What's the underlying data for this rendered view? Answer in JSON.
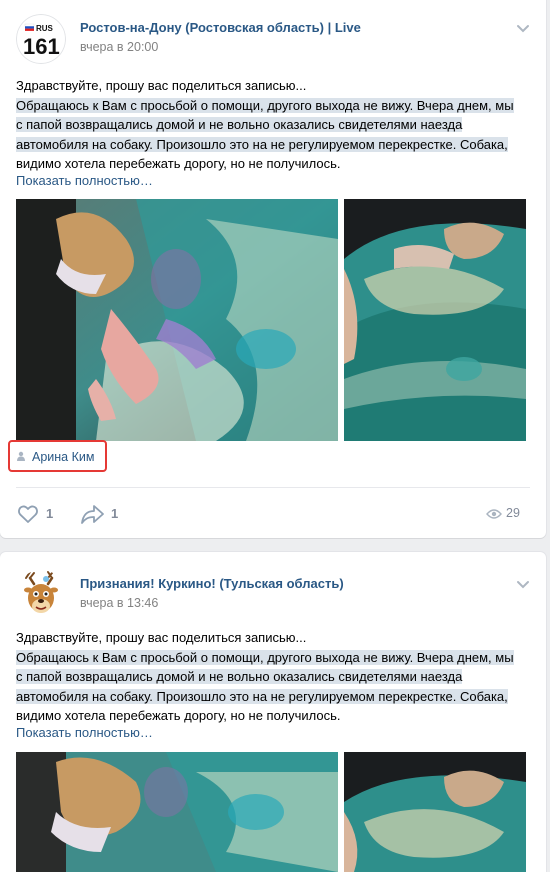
{
  "posts": [
    {
      "author": "Ростов-на-Дону (Ростовская область) | Live",
      "date": "вчера в 20:00",
      "avatar_text_top": "RUS",
      "avatar_text_bottom": "161",
      "line1": "Здравствуйте, прошу вас поделиться записью...",
      "line2": "Обращаюсь к Вам с просьбой о помощи, другого выхода не вижу. Вчера днем, мы",
      "line3": "с папой возвращались домой и не вольно оказались свидетелями наезда",
      "line4": "автомобиля на собаку. Произошло это на не регулируемом перекрестке. Собака,",
      "line5": "видимо хотела перебежать дорогу, но не получилось.",
      "show_more": "Показать полностью…",
      "signer": "Арина Ким",
      "likes": "1",
      "shares": "1",
      "views": "29"
    },
    {
      "author": "Признания! Куркино! (Тульская область)",
      "date": "вчера в 13:46",
      "line1": "Здравствуйте, прошу вас поделиться записью...",
      "line2": "Обращаюсь к Вам с просьбой о помощи, другого выхода не вижу. Вчера днем, мы",
      "line3": "с папой возвращались домой и не вольно оказались свидетелями наезда",
      "line4": "автомобиля на собаку. Произошло это на не регулируемом перекрестке. Собака,",
      "line5": "видимо хотела перебежать дорогу, но не получилось.",
      "show_more": "Показать полностью…"
    }
  ],
  "icons": {
    "chevron": "chevron-down-icon",
    "like": "heart-icon",
    "share": "share-arrow-icon",
    "views": "eye-icon",
    "signer": "person-icon"
  },
  "colors": {
    "link": "#2a5885",
    "muted": "#828282",
    "highlight": "#dae2ea",
    "signer_box": "#e53935"
  }
}
